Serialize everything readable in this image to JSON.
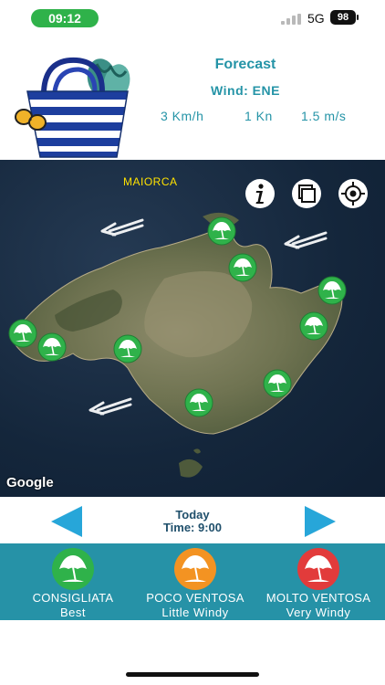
{
  "status_bar": {
    "time": "09:12",
    "network": "5G",
    "battery": "98"
  },
  "forecast": {
    "title": "Forecast",
    "wind": "Wind: ENE",
    "speed_kmh": "3 Km/h",
    "speed_kn": "1 Kn",
    "speed_ms": "1.5 m/s"
  },
  "map": {
    "label": "MAIORCA",
    "attribution": "Google",
    "buttons": [
      "info-icon",
      "layers-icon",
      "locate-icon"
    ],
    "marker_color": "#2fb24a",
    "beach_markers": 10,
    "wind_arrows": 3
  },
  "day_nav": {
    "day": "Today",
    "time": "Time: 9:00",
    "arrow_color": "#27a6d9"
  },
  "legend": [
    {
      "title": "CONSIGLIATA",
      "subtitle": "Best",
      "color": "#2fb24a",
      "icon": "beach-umbrella-icon"
    },
    {
      "title": "POCO VENTOSA",
      "subtitle": "Little Windy",
      "color": "#f39322",
      "icon": "beach-umbrella-icon"
    },
    {
      "title": "MOLTO VENTOSA",
      "subtitle": "Very Windy",
      "color": "#e23b3b",
      "icon": "beach-umbrella-icon"
    }
  ]
}
